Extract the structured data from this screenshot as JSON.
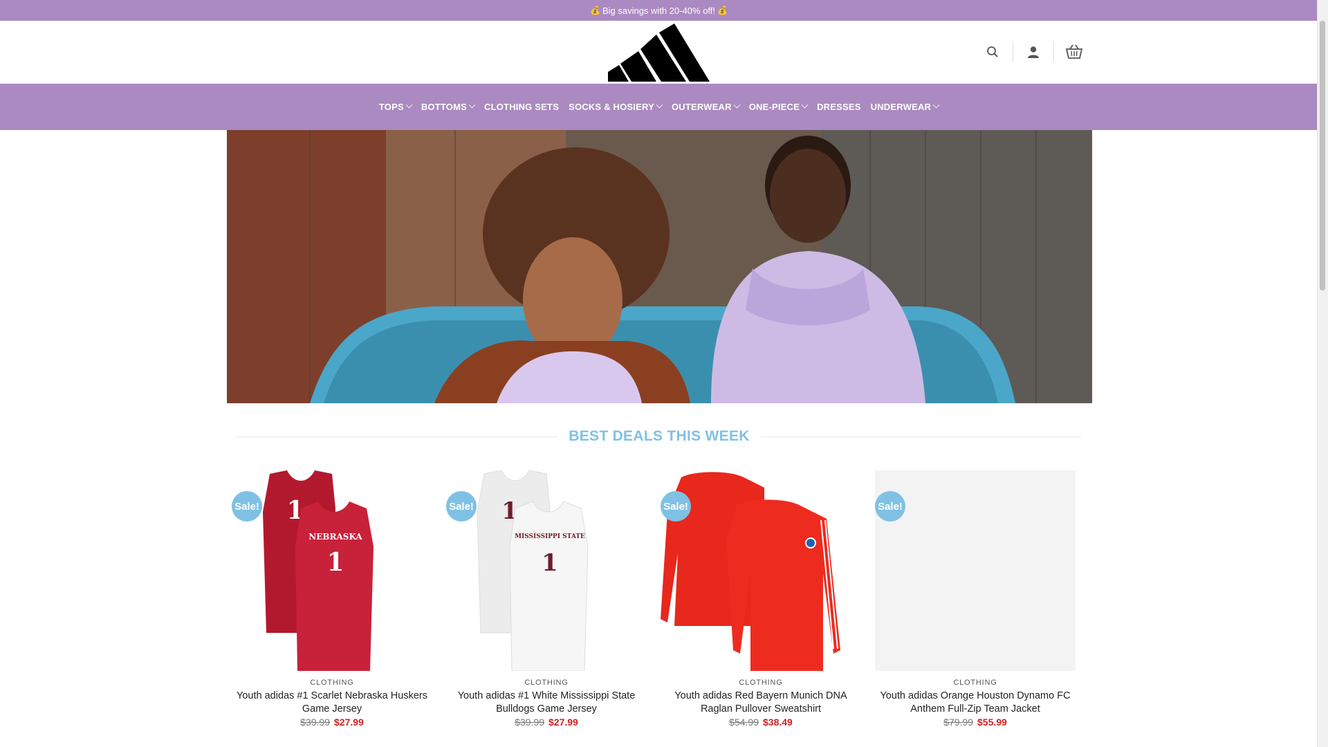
{
  "promo": {
    "text": "Big savings with 20-40% off!",
    "icon": "money-bag-icon"
  },
  "header": {
    "logo": "adidas-logo",
    "icons": [
      "search-icon",
      "account-icon",
      "basket-icon"
    ]
  },
  "nav": {
    "items": [
      {
        "label": "TOPS",
        "has_dropdown": true
      },
      {
        "label": "BOTTOMS",
        "has_dropdown": true
      },
      {
        "label": "CLOTHING SETS",
        "has_dropdown": false
      },
      {
        "label": "SOCKS & HOSIERY",
        "has_dropdown": true
      },
      {
        "label": "OUTERWEAR",
        "has_dropdown": true
      },
      {
        "label": "ONE-PIECE",
        "has_dropdown": true
      },
      {
        "label": "DRESSES",
        "has_dropdown": false
      },
      {
        "label": "UNDERWEAR",
        "has_dropdown": true
      }
    ]
  },
  "hero": {
    "image": "two children in lilac hoodies sitting on a blue truck"
  },
  "section": {
    "title": "BEST DEALS THIS WEEK"
  },
  "products": [
    {
      "badge": "Sale!",
      "category": "CLOTHING",
      "name": "Youth adidas #1 Scarlet Nebraska Huskers Game Jersey",
      "old_price": "$39.99",
      "price": "$27.99",
      "jersey_text": "NEBRASKA",
      "jersey_number": "1"
    },
    {
      "badge": "Sale!",
      "category": "CLOTHING",
      "name": "Youth adidas #1 White Mississippi State Bulldogs Game Jersey",
      "old_price": "$39.99",
      "price": "$27.99",
      "jersey_text": "MISSISSIPPI STATE",
      "jersey_number": "1"
    },
    {
      "badge": "Sale!",
      "category": "CLOTHING",
      "name": "Youth adidas Red Bayern Munich DNA Raglan Pullover Sweatshirt",
      "old_price": "$54.99",
      "price": "$38.49"
    },
    {
      "badge": "Sale!",
      "category": "CLOTHING",
      "name": "Youth adidas Orange Houston Dynamo FC Anthem Full-Zip Team Jacket",
      "old_price": "$79.99",
      "price": "$55.99"
    }
  ],
  "colors": {
    "brand_purple": "#aa8ac0",
    "accent_blue": "#7fc1e4",
    "sale_red": "#d21f1f"
  }
}
